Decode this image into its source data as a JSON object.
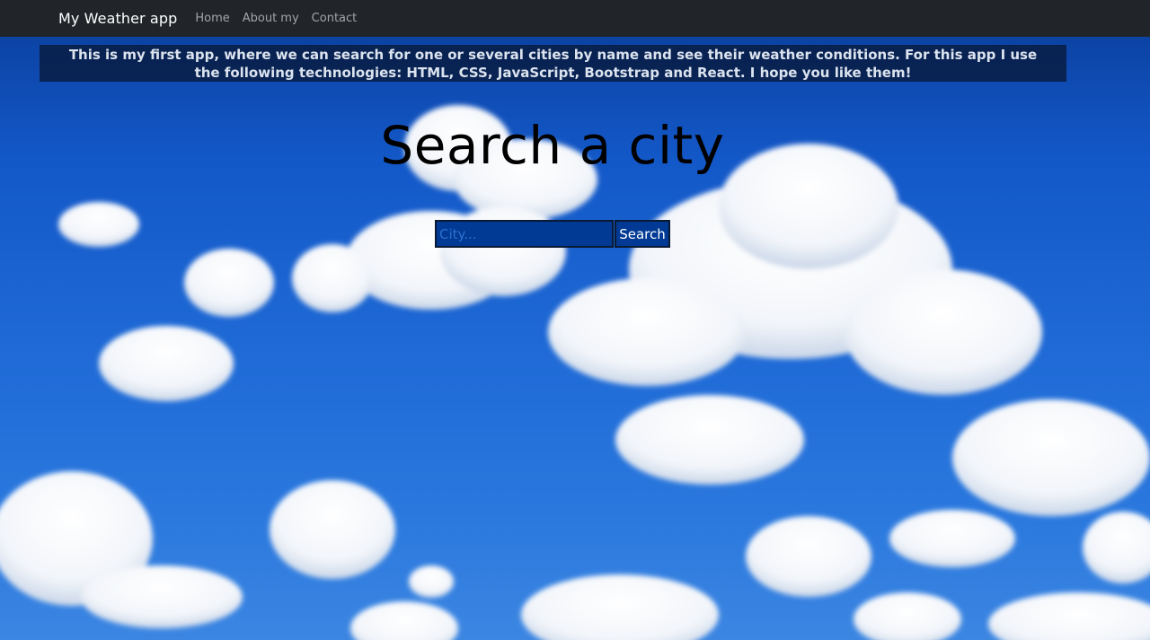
{
  "navbar": {
    "brand": "My Weather app",
    "links": [
      "Home",
      "About my",
      "Contact"
    ]
  },
  "intro": {
    "text": "This is my first app, where we can search for one or several cities by name and see their weather conditions. For this app I use the following technologies: HTML, CSS, JavaScript, Bootstrap and React. I hope you like them!"
  },
  "main": {
    "title": "Search a city",
    "search": {
      "placeholder": "City...",
      "value": "",
      "button_label": "Search"
    }
  },
  "colors": {
    "navbar_bg": "#212529",
    "sky_blue": "#1f6ad6",
    "input_bg": "#003a94",
    "cloud": "#ffffff"
  }
}
